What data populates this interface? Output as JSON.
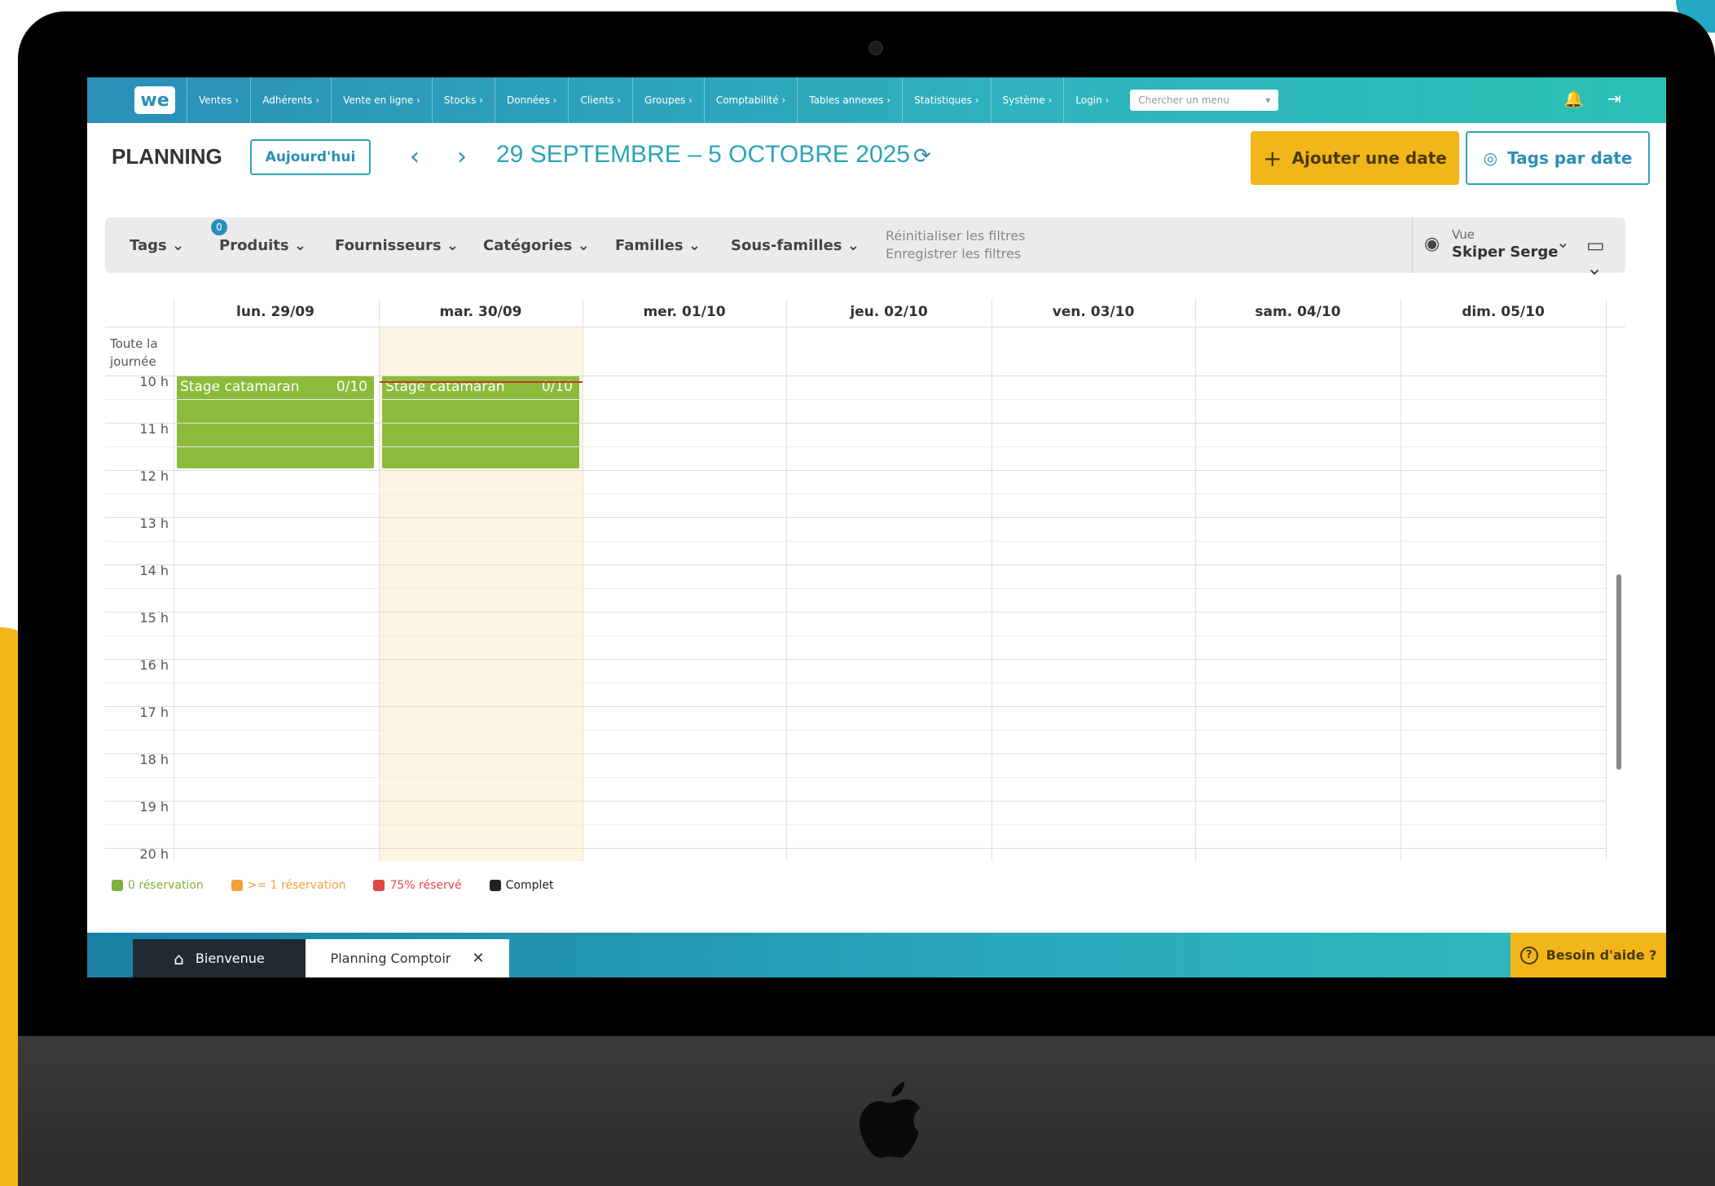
{
  "nav": {
    "logo": "we",
    "items": [
      "Ventes ›",
      "Adhérents ›",
      "Vente en ligne ›",
      "Stocks ›",
      "Données ›",
      "Clients ›",
      "Groupes ›",
      "Comptabilité ›",
      "Tables annexes ›",
      "Statistiques ›",
      "Système ›",
      "Login ›"
    ],
    "search_placeholder": "Chercher un menu",
    "search_caret": "▾",
    "bell_icon": "🔔",
    "logout_icon": "⇥"
  },
  "header": {
    "title": "PLANNING",
    "today_button": "Aujourd'hui",
    "prev_icon": "‹",
    "next_icon": "›",
    "date_range": "29 SEPTEMBRE – 5 OCTOBRE 2025",
    "refresh_icon": "⟳",
    "add_button": "Ajouter une date",
    "add_icon": "+",
    "tags_button": "Tags par date",
    "tags_icon": "◎"
  },
  "filters": {
    "tags": "Tags ⌄",
    "tags_badge": "0",
    "produits": "Produits ⌄",
    "fournisseurs": "Fournisseurs ⌄",
    "categories": "Catégories ⌄",
    "familles": "Familles ⌄",
    "sous_familles": "Sous-familles ⌄",
    "reset": "Réinitialiser les filtres",
    "save": "Enregistrer les filtres",
    "view_label": "Vue",
    "view_value": "Skiper Serge",
    "view_caret": "⌄",
    "eye_icon": "◉",
    "calendar_icon": "▭ ⌄"
  },
  "calendar": {
    "days": [
      "lun. 29/09",
      "mar. 30/09",
      "mer. 01/10",
      "jeu. 02/10",
      "ven. 03/10",
      "sam. 04/10",
      "dim. 05/10"
    ],
    "all_day_line1": "Toute la",
    "all_day_line2": "journée",
    "hours": [
      "10 h",
      "11 h",
      "12 h",
      "13 h",
      "14 h",
      "15 h",
      "16 h",
      "17 h",
      "18 h",
      "19 h",
      "20 h"
    ],
    "events": [
      {
        "name": "Stage catamaran",
        "count": "0/10"
      },
      {
        "name": "Stage catamaran",
        "count": "0/10"
      }
    ]
  },
  "legend": [
    {
      "label": "0 réservation",
      "color": "#7fb23a"
    },
    {
      "label": ">= 1 réservation",
      "color": "#f0a23a"
    },
    {
      "label": "75% réservé",
      "color": "#e04848"
    },
    {
      "label": "Complet",
      "color": "#222222"
    }
  ],
  "bottom": {
    "home_icon": "⌂",
    "tab1": "Bienvenue",
    "tab2": "Planning Comptoir",
    "close_icon": "✕",
    "help_icon": "?",
    "help": "Besoin d'aide ?"
  },
  "colors": {
    "brand_teal": "#2aa5b8",
    "accent_yellow": "#f2b61b",
    "event_green": "#8bbb3a",
    "today_bg": "#fdf5e2"
  }
}
